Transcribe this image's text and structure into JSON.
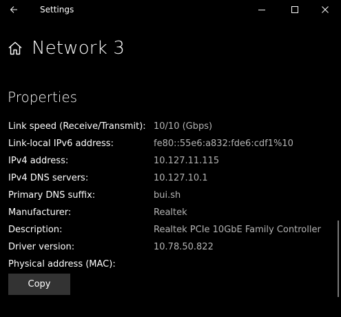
{
  "window": {
    "app_title": "Settings",
    "back_icon": "arrow-left-icon",
    "minimize_icon": "minimize-icon",
    "maximize_icon": "maximize-icon",
    "close_icon": "close-icon"
  },
  "header": {
    "icon": "home-icon",
    "title": "Network 3"
  },
  "properties": {
    "section_title": "Properties",
    "rows": [
      {
        "label": "Link speed (Receive/Transmit):",
        "value": "10/10 (Gbps)"
      },
      {
        "label": "Link-local IPv6 address:",
        "value": "fe80::55e6:a832:fde6:cdf1%10"
      },
      {
        "label": "IPv4 address:",
        "value": "10.127.11.115"
      },
      {
        "label": "IPv4 DNS servers:",
        "value": "10.127.10.1"
      },
      {
        "label": "Primary DNS suffix:",
        "value": "bui.sh"
      },
      {
        "label": "Manufacturer:",
        "value": "Realtek"
      },
      {
        "label": "Description:",
        "value": "Realtek PCIe 10GbE Family Controller"
      },
      {
        "label": "Driver version:",
        "value": "10.78.50.822"
      },
      {
        "label": "Physical address (MAC):",
        "value": ""
      }
    ],
    "copy_label": "Copy"
  },
  "colors": {
    "background": "#000000",
    "text": "#ffffff",
    "value_text": "#b4b4b4",
    "button_bg": "#333333"
  }
}
